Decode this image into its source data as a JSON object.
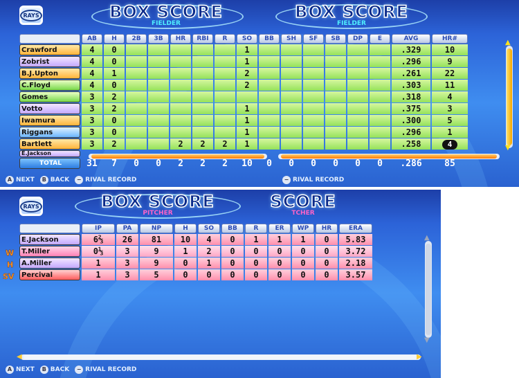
{
  "top": {
    "titles": [
      {
        "main": "BOX SCORE",
        "sub": "FIELDER"
      },
      {
        "main": "BOX SCORE",
        "sub": "FIELDER"
      }
    ],
    "logo_text": "RAYS",
    "columns": [
      "AB",
      "H",
      "2B",
      "3B",
      "HR",
      "RBI",
      "R",
      "SO",
      "BB",
      "SH",
      "SF",
      "SB",
      "DP",
      "E",
      "AVG",
      "HR#"
    ],
    "rows": [
      {
        "name": "Crawford",
        "color": "n-orange",
        "vals": [
          "4",
          "0",
          "",
          "",
          "",
          "",
          "",
          "1",
          "",
          "",
          "",
          "",
          "",
          "",
          ".329",
          "10"
        ]
      },
      {
        "name": "Zobrist",
        "color": "n-purple",
        "vals": [
          "4",
          "0",
          "",
          "",
          "",
          "",
          "",
          "1",
          "",
          "",
          "",
          "",
          "",
          "",
          ".296",
          "9"
        ]
      },
      {
        "name": "B.J.Upton",
        "color": "n-orange",
        "vals": [
          "4",
          "1",
          "",
          "",
          "",
          "",
          "",
          "2",
          "",
          "",
          "",
          "",
          "",
          "",
          ".261",
          "22"
        ]
      },
      {
        "name": "C.Floyd",
        "color": "n-green",
        "vals": [
          "4",
          "0",
          "",
          "",
          "",
          "",
          "",
          "2",
          "",
          "",
          "",
          "",
          "",
          "",
          ".303",
          "11"
        ]
      },
      {
        "name": "Gomes",
        "color": "n-green",
        "vals": [
          "3",
          "2",
          "",
          "",
          "",
          "",
          "",
          "",
          "",
          "",
          "",
          "",
          "",
          "",
          ".318",
          "4"
        ]
      },
      {
        "name": "Votto",
        "color": "n-purple",
        "vals": [
          "3",
          "2",
          "",
          "",
          "",
          "",
          "",
          "1",
          "",
          "",
          "",
          "",
          "",
          "",
          ".375",
          "3"
        ]
      },
      {
        "name": "Iwamura",
        "color": "n-orange",
        "vals": [
          "3",
          "0",
          "",
          "",
          "",
          "",
          "",
          "1",
          "",
          "",
          "",
          "",
          "",
          "",
          ".300",
          "5"
        ]
      },
      {
        "name": "Riggans",
        "color": "n-blue",
        "vals": [
          "3",
          "0",
          "",
          "",
          "",
          "",
          "",
          "1",
          "",
          "",
          "",
          "",
          "",
          "",
          ".296",
          "1"
        ]
      },
      {
        "name": "Bartlett",
        "color": "n-orange",
        "vals": [
          "3",
          "2",
          "",
          "",
          "2",
          "2",
          "2",
          "1",
          "",
          "",
          "",
          "",
          "",
          "",
          ".258",
          "4"
        ]
      }
    ],
    "partial_row": "E.Jackson",
    "total_label": "TOTAL",
    "totals": [
      "31",
      "7",
      "0",
      "0",
      "2",
      "2",
      "2",
      "10",
      "0",
      "0",
      "0",
      "0",
      "0",
      "0",
      ".286",
      "85"
    ],
    "bottom": {
      "a": "NEXT",
      "b": "BACK",
      "minus": "RIVAL RECORD",
      "minus2": "RIVAL RECORD"
    }
  },
  "bottom_screen": {
    "titles": [
      {
        "main": "BOX SCORE",
        "sub": "PITCHER"
      },
      {
        "main": "SCORE",
        "sub": "TCHER"
      }
    ],
    "logo_text": "RAYS",
    "columns": [
      "IP",
      "PA",
      "NP",
      "H",
      "SO",
      "BB",
      "R",
      "ER",
      "WP",
      "HR",
      "ERA"
    ],
    "rows": [
      {
        "role": "",
        "name": "E.Jackson",
        "color": "n-purple",
        "row": "pink",
        "vals": [
          "6⅔",
          "26",
          "81",
          "10",
          "4",
          "0",
          "1",
          "1",
          "1",
          "0",
          "5.83"
        ]
      },
      {
        "role": "W",
        "name": "T.Miller",
        "color": "n-pink",
        "row": "pink2",
        "vals": [
          "0⅓",
          "3",
          "9",
          "1",
          "2",
          "0",
          "0",
          "0",
          "0",
          "0",
          "3.72"
        ]
      },
      {
        "role": "H",
        "name": "A.Miller",
        "color": "n-purple",
        "row": "pink",
        "vals": [
          "1",
          "3",
          "9",
          "0",
          "1",
          "0",
          "0",
          "0",
          "0",
          "0",
          "2.18"
        ]
      },
      {
        "role": "SV",
        "name": "Percival",
        "color": "n-red",
        "row": "pink",
        "vals": [
          "1",
          "3",
          "5",
          "0",
          "0",
          "0",
          "0",
          "0",
          "0",
          "0",
          "3.57"
        ]
      }
    ],
    "bottom": {
      "a": "NEXT",
      "b": "BACK",
      "minus": "RIVAL RECORD"
    }
  }
}
